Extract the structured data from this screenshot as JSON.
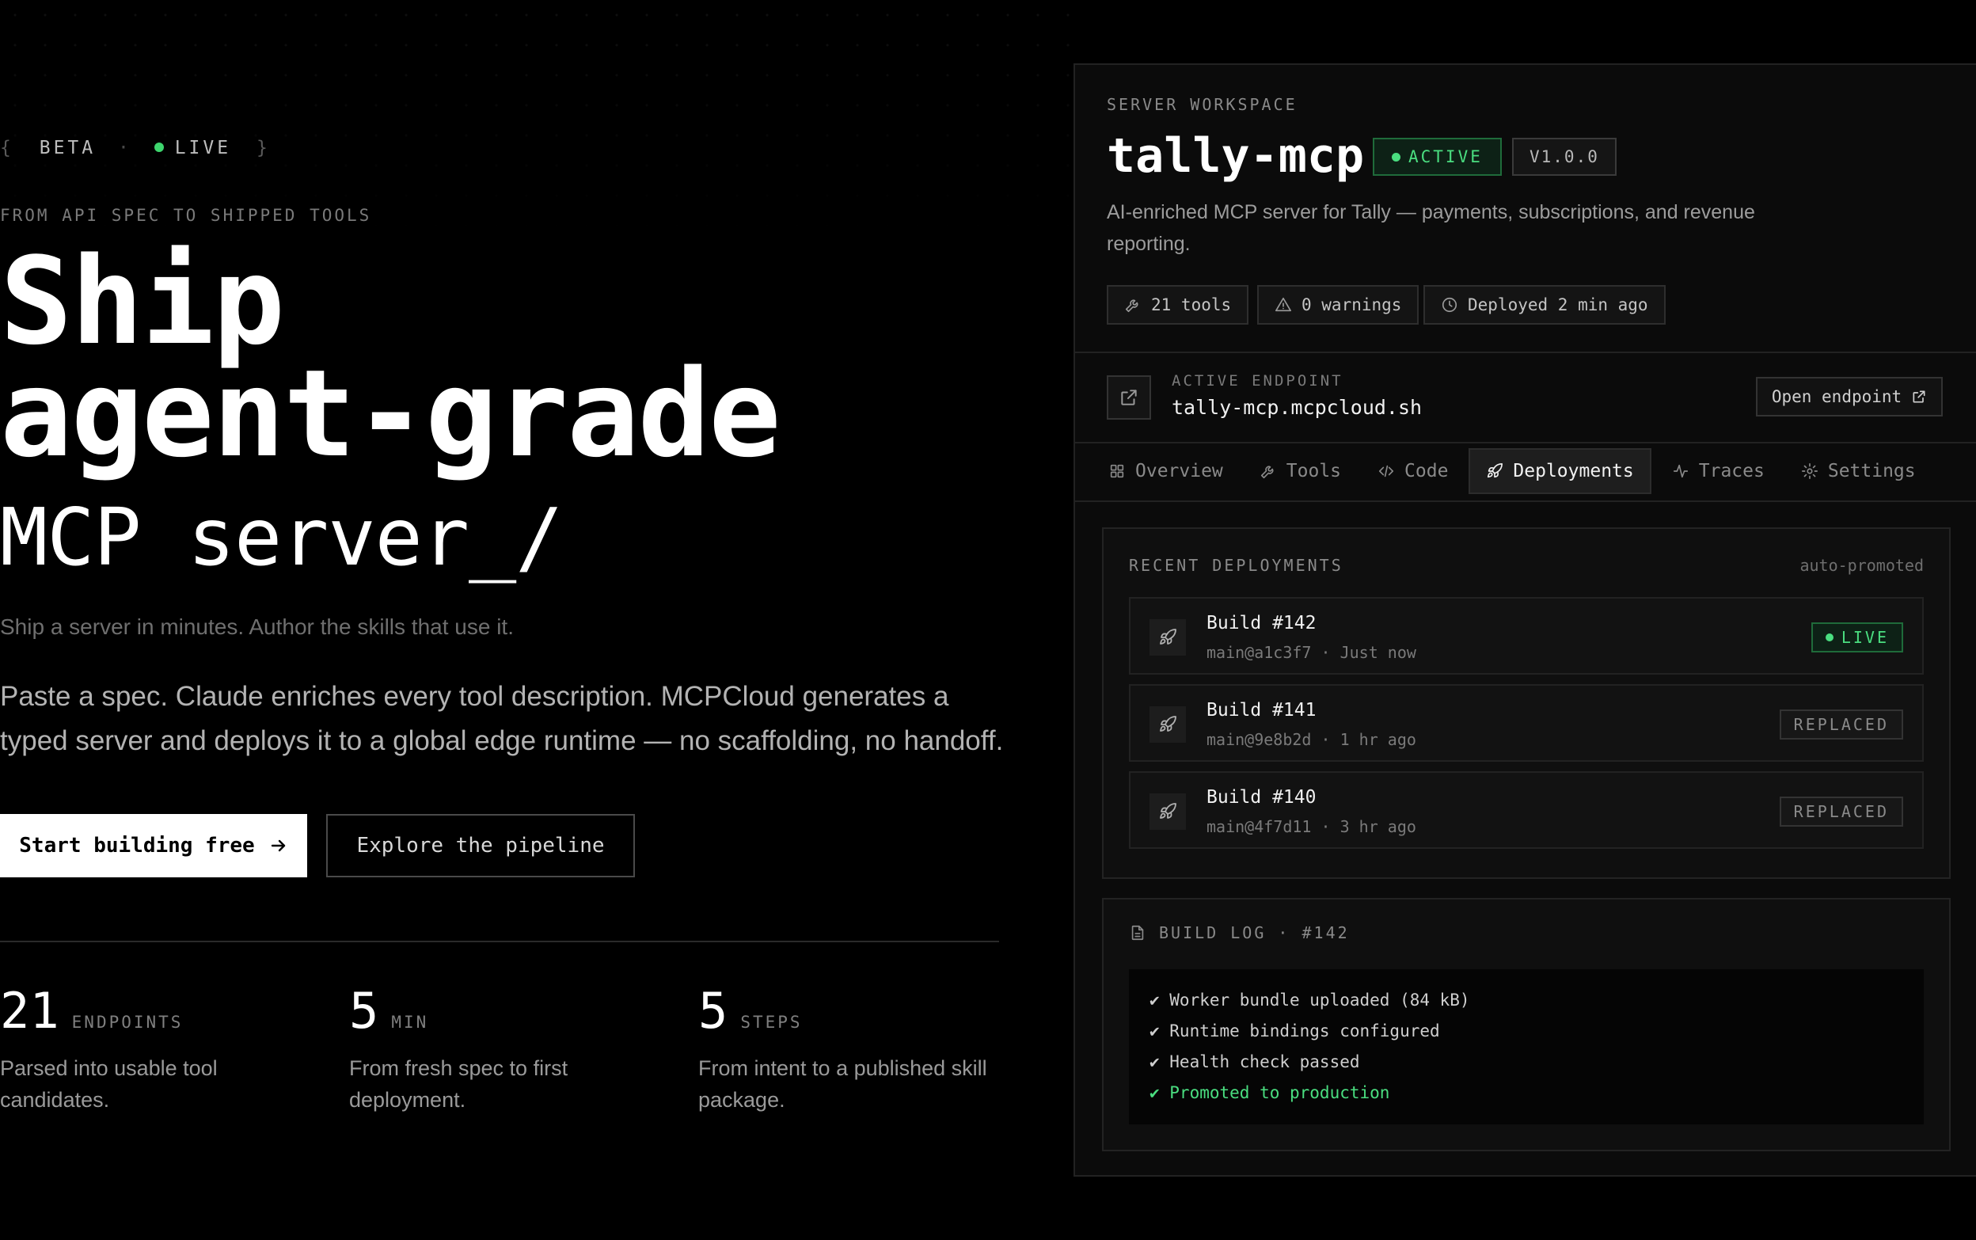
{
  "hero": {
    "badge": {
      "open": "{",
      "beta": "BETA",
      "sep": "·",
      "live": "LIVE",
      "close": "}"
    },
    "eyebrow": "FROM API SPEC TO SHIPPED TOOLS",
    "title_line1": "Ship",
    "title_line2": "agent-grade",
    "title_line3": "MCP server_/",
    "tagline": "Ship a server in minutes. Author the skills that use it.",
    "lead": "Paste a spec. Claude enriches every tool description. MCPCloud generates a typed server and deploys it to a global edge runtime — no scaffolding, no handoff.",
    "primary_cta": "Start building free",
    "secondary_cta": "Explore the pipeline",
    "stats": [
      {
        "value": "21",
        "unit": "ENDPOINTS",
        "desc": "Parsed into usable tool candidates."
      },
      {
        "value": "5",
        "unit": "MIN",
        "desc": "From fresh spec to first deployment."
      },
      {
        "value": "5",
        "unit": "STEPS",
        "desc": "From intent to a published skill package."
      }
    ]
  },
  "workspace": {
    "eyebrow": "SERVER WORKSPACE",
    "name": "tally-mcp",
    "status": "ACTIVE",
    "version": "V1.0.0",
    "description": "AI-enriched MCP server for Tally — payments, subscriptions, and revenue reporting.",
    "chips": {
      "tools": "21 tools",
      "warnings": "0 warnings",
      "deployed": "Deployed 2 min ago"
    },
    "endpoint": {
      "label": "ACTIVE ENDPOINT",
      "url": "tally-mcp.mcpcloud.sh",
      "open_label": "Open endpoint"
    },
    "tabs": [
      {
        "label": "Overview",
        "icon": "grid-icon"
      },
      {
        "label": "Tools",
        "icon": "wrench-icon"
      },
      {
        "label": "Code",
        "icon": "code-icon"
      },
      {
        "label": "Deployments",
        "icon": "rocket-icon",
        "active": true
      },
      {
        "label": "Traces",
        "icon": "activity-icon"
      },
      {
        "label": "Settings",
        "icon": "gear-icon"
      }
    ],
    "deployments": {
      "title": "RECENT DEPLOYMENTS",
      "note": "auto-promoted",
      "items": [
        {
          "name": "Build #142",
          "meta": "main@a1c3f7 · Just now",
          "status": "LIVE"
        },
        {
          "name": "Build #141",
          "meta": "main@9e8b2d · 1 hr ago",
          "status": "REPLACED"
        },
        {
          "name": "Build #140",
          "meta": "main@4f7d11 · 3 hr ago",
          "status": "REPLACED"
        }
      ]
    },
    "build_log": {
      "title": "BUILD LOG · #142",
      "lines": [
        "✔ Worker bundle uploaded (84 kB)",
        "✔ Runtime bindings configured",
        "✔ Health check passed",
        "✔ Promoted to production"
      ]
    }
  },
  "colors": {
    "background": "#000000",
    "accent_green": "#4ade80",
    "panel": "#0b0b0b"
  }
}
